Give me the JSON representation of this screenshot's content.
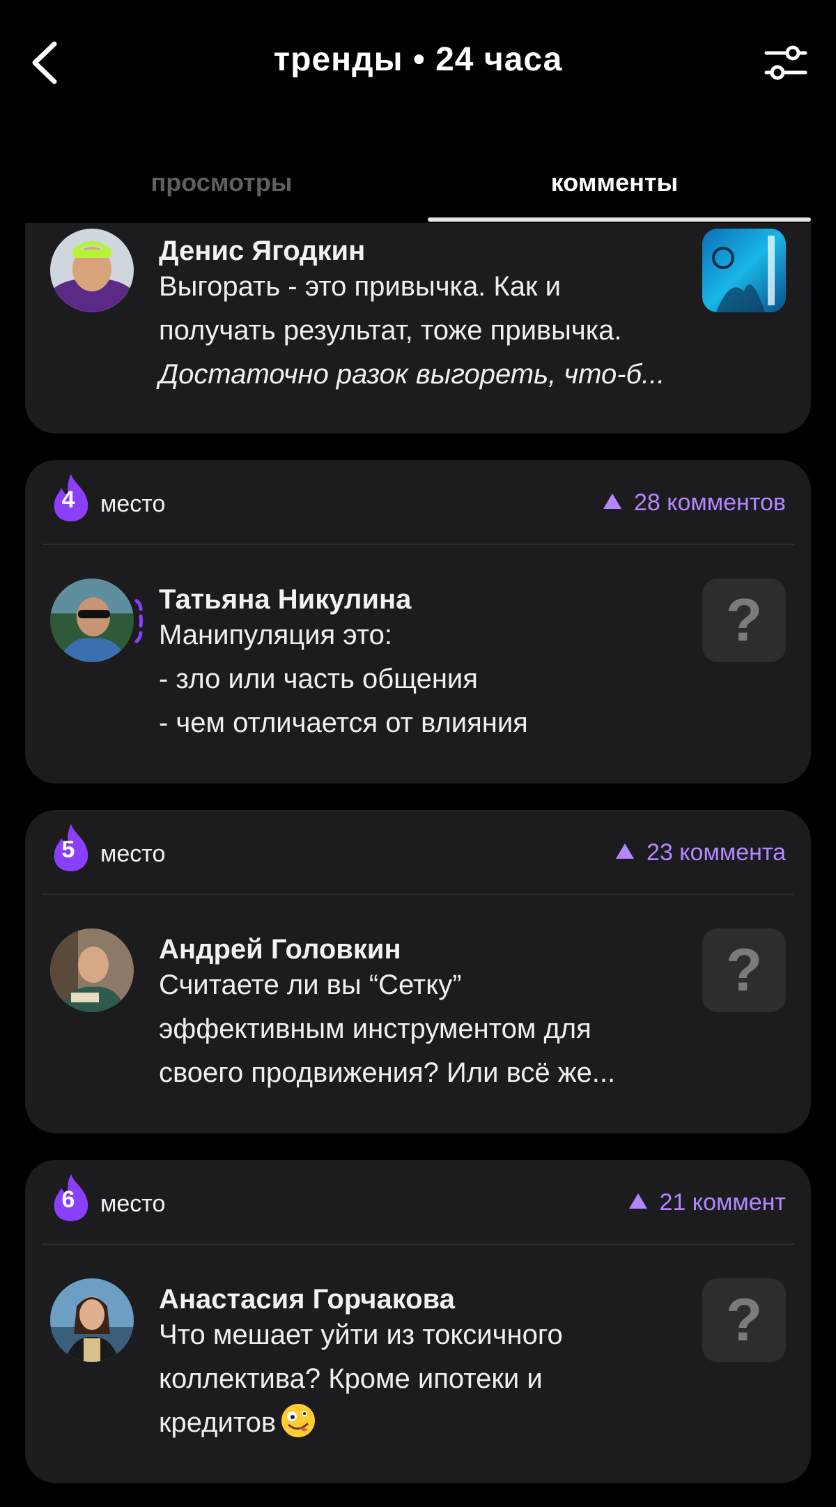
{
  "header": {
    "title": "тренды • 24 часа",
    "back_icon": "chevron-left-icon",
    "filter_icon": "sliders-icon"
  },
  "tabs": [
    {
      "label": "просмотры",
      "active": false
    },
    {
      "label": "комменты",
      "active": true
    }
  ],
  "colors": {
    "accent": "#b387ff",
    "flame": "#8a3ffc",
    "card": "#1c1c1f",
    "background": "#000000"
  },
  "entries": [
    {
      "author": "Денис Ягодкин",
      "lines": [
        "Выгорать - это привычка. Как и",
        "получать результат, тоже привычка."
      ],
      "italic_line": "Достаточно разок выгореть, что-б...",
      "thumb": "image"
    },
    {
      "rank": "4",
      "rank_label": "место",
      "count": "28 комментов",
      "author": "Татьяна Никулина",
      "lines": [
        "Манипуляция это:",
        "- зло или часть общения",
        "- чем отличается от влияния"
      ],
      "thumb": "?"
    },
    {
      "rank": "5",
      "rank_label": "место",
      "count": "23 коммента",
      "author": "Андрей Головкин",
      "lines": [
        "Считаете ли вы “Сетку”",
        "эффективным инструментом для",
        "своего продвижения? Или всё же..."
      ],
      "thumb": "?"
    },
    {
      "rank": "6",
      "rank_label": "место",
      "count": "21 коммент",
      "author": "Анастасия Горчакова",
      "lines": [
        "Что мешает уйти из токсичного",
        "коллектива? Кроме ипотеки и",
        "кредитов"
      ],
      "emoji": "zany-face-emoji",
      "thumb": "?"
    }
  ]
}
